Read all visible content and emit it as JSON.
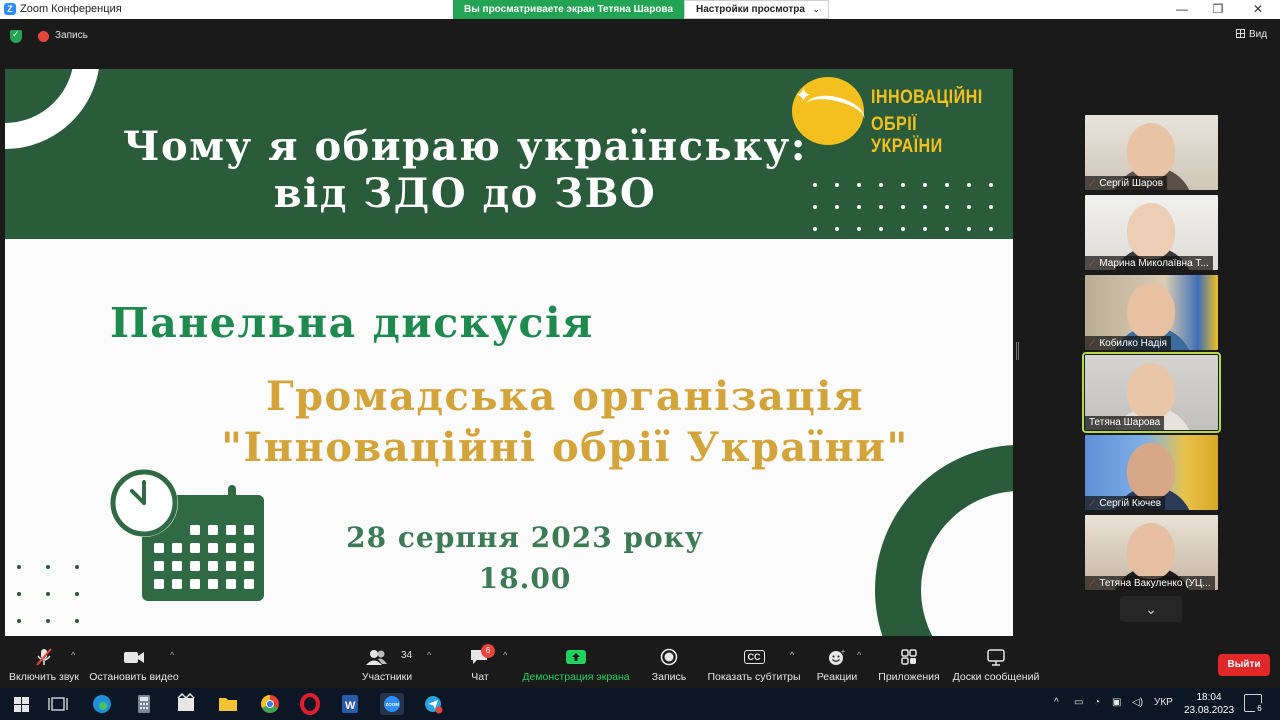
{
  "window": {
    "app_title": "Zoom Конференция",
    "share_banner": "Вы просматриваете экран Тетяна Шарова",
    "view_settings": "Настройки просмотра"
  },
  "meeting_bar": {
    "record_label": "Запись",
    "view_label": "Вид"
  },
  "slide": {
    "title_line1": "Чому я обираю українську:",
    "title_line2": "від ЗДО до ЗВО",
    "logo_line1": "ІННОВАЦІЙНІ",
    "logo_line2": "ОБРІЇ УКРАЇНИ",
    "subtitle": "Панельна дискусія",
    "org_line1": "Громадська організація",
    "org_line2": "\"Інноваційні обрії України\"",
    "date": "28 серпня 2023 року",
    "time": "18.00",
    "colors": {
      "band": "#2a5b3a",
      "subtitle": "#1f8a4f",
      "org": "#d3a43a",
      "date": "#3d7a56",
      "logo": "#f3c020"
    }
  },
  "participants": [
    {
      "name": "Сергій Шаров",
      "muted": true
    },
    {
      "name": "Марина Миколаївна Т...",
      "muted": true
    },
    {
      "name": "Кобилко Надія",
      "muted": true
    },
    {
      "name": "Тетяна Шарова",
      "muted": false,
      "active": true
    },
    {
      "name": "Сергій Кючев",
      "muted": true
    },
    {
      "name": "Тетяна Вакуленко (УЦ...",
      "muted": true
    }
  ],
  "toolbar": {
    "unmute": "Включить звук",
    "stop_video": "Остановить видео",
    "participants": "Участники",
    "participants_count": "34",
    "chat": "Чат",
    "chat_badge": "6",
    "share_screen": "Демонстрация экрана",
    "record": "Запись",
    "captions": "Показать субтитры",
    "captions_icon": "CC",
    "reactions": "Реакции",
    "apps": "Приложения",
    "whiteboards": "Доски сообщений",
    "leave": "Выйти"
  },
  "taskbar": {
    "language": "УКР",
    "time": "18:04",
    "date": "23.08.2023",
    "notifications": "6",
    "zoom_icon_label": "ZOOM"
  }
}
